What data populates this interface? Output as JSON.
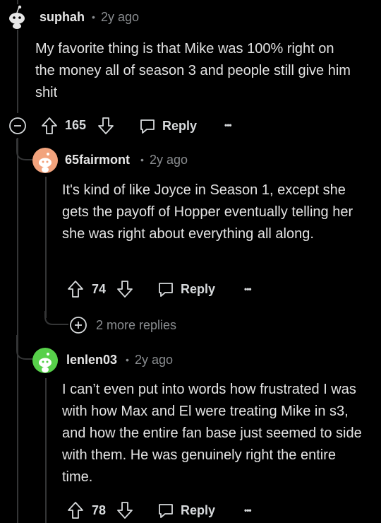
{
  "comments": [
    {
      "username": "suphah",
      "age": "2y ago",
      "body": "My favorite thing is that Mike was 100% right on the money all of season 3 and people still give him shit",
      "votes": "165",
      "reply_label": "Reply",
      "more_label": "•••"
    },
    {
      "username": "65fairmont",
      "age": "2y ago",
      "body": "It's kind of like Joyce in Season 1, except she gets the payoff of Hopper eventually telling her she was right about everything all along.",
      "votes": "74",
      "reply_label": "Reply",
      "more_label": "•••",
      "avatar_color": "#f2a37d"
    },
    {
      "username": "lenlen03",
      "age": "2y ago",
      "body": "I can’t even put into words how frustrated I was with how Max and El were treating Mike in s3, and how the entire fan base just seemed to side with them. He was genuinely right the entire time.",
      "votes": "78",
      "reply_label": "Reply",
      "more_label": "•••",
      "avatar_color": "#57d04a"
    }
  ],
  "more_replies": {
    "label": "2 more replies"
  },
  "separator": "•",
  "icons": {
    "collapse": "minus-circle-icon",
    "upvote": "arrow-up-icon",
    "downvote": "arrow-down-icon",
    "reply": "speech-bubble-icon",
    "more": "ellipsis-icon",
    "expand": "plus-circle-icon"
  }
}
